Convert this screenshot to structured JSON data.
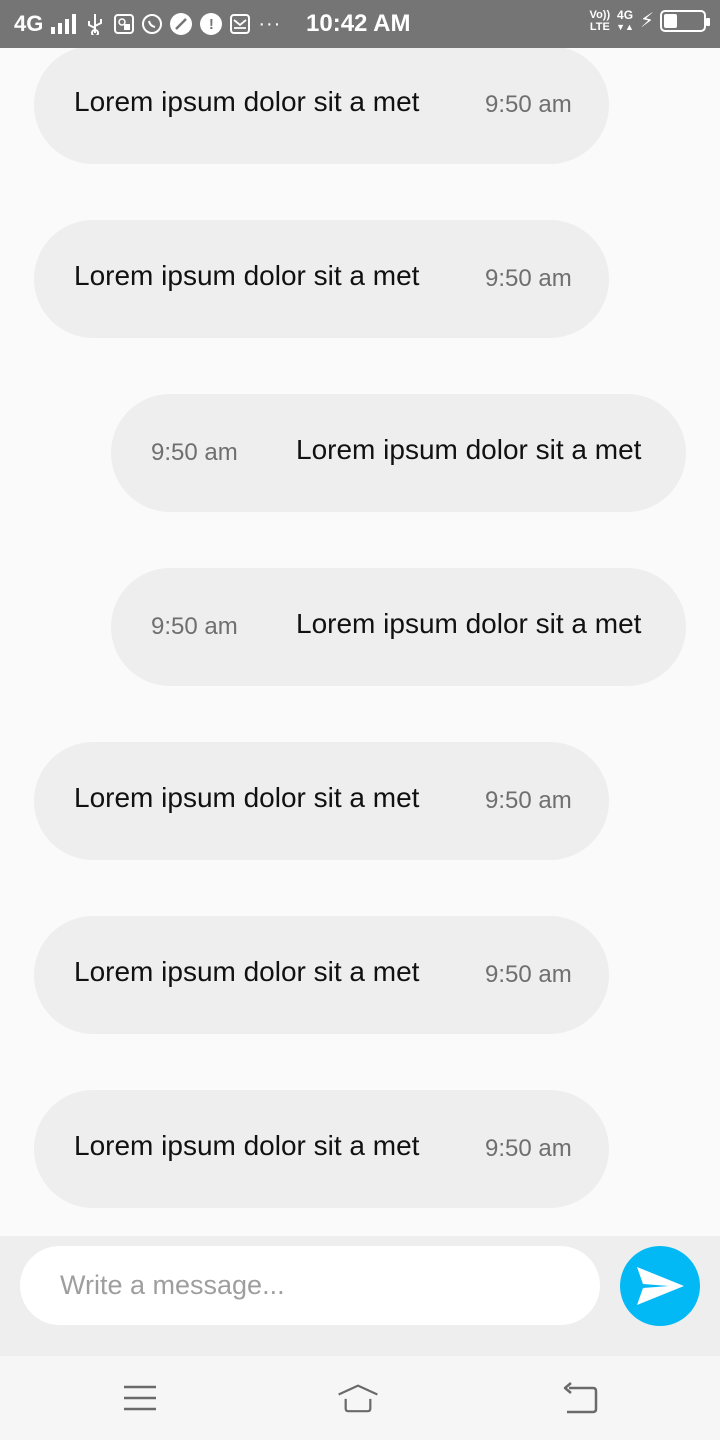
{
  "status_bar": {
    "network": "4G",
    "time": "10:42 AM",
    "volte": "Vo)) LTE",
    "volte_top": "Vo))",
    "volte_bottom": "LTE",
    "net_right_top": "4G",
    "net_right_bottom": "▼▲",
    "icons": [
      "signal-icon",
      "usb-icon",
      "usb-debug-icon",
      "whatsapp-icon",
      "leaf-icon",
      "alert-icon",
      "mail-icon",
      "more-icon"
    ],
    "battery_level": 0.35
  },
  "messages": [
    {
      "direction": "received",
      "text": "Lorem ipsum dolor sit a met",
      "time": "9:50 am"
    },
    {
      "direction": "received",
      "text": "Lorem ipsum dolor sit a met",
      "time": "9:50 am"
    },
    {
      "direction": "sent",
      "text": "Lorem ipsum dolor sit a met",
      "time": "9:50 am"
    },
    {
      "direction": "sent",
      "text": "Lorem ipsum dolor sit a met",
      "time": "9:50 am"
    },
    {
      "direction": "received",
      "text": "Lorem ipsum dolor sit a met",
      "time": "9:50 am"
    },
    {
      "direction": "received",
      "text": "Lorem ipsum dolor sit a met",
      "time": "9:50 am"
    },
    {
      "direction": "received",
      "text": "Lorem ipsum dolor sit a met",
      "time": "9:50 am"
    }
  ],
  "composer": {
    "placeholder": "Write a message...",
    "value": "",
    "send_icon": "send-icon",
    "send_color": "#03b9f5"
  },
  "nav_bar": {
    "icons": [
      "menu-icon",
      "home-icon",
      "back-icon"
    ]
  }
}
